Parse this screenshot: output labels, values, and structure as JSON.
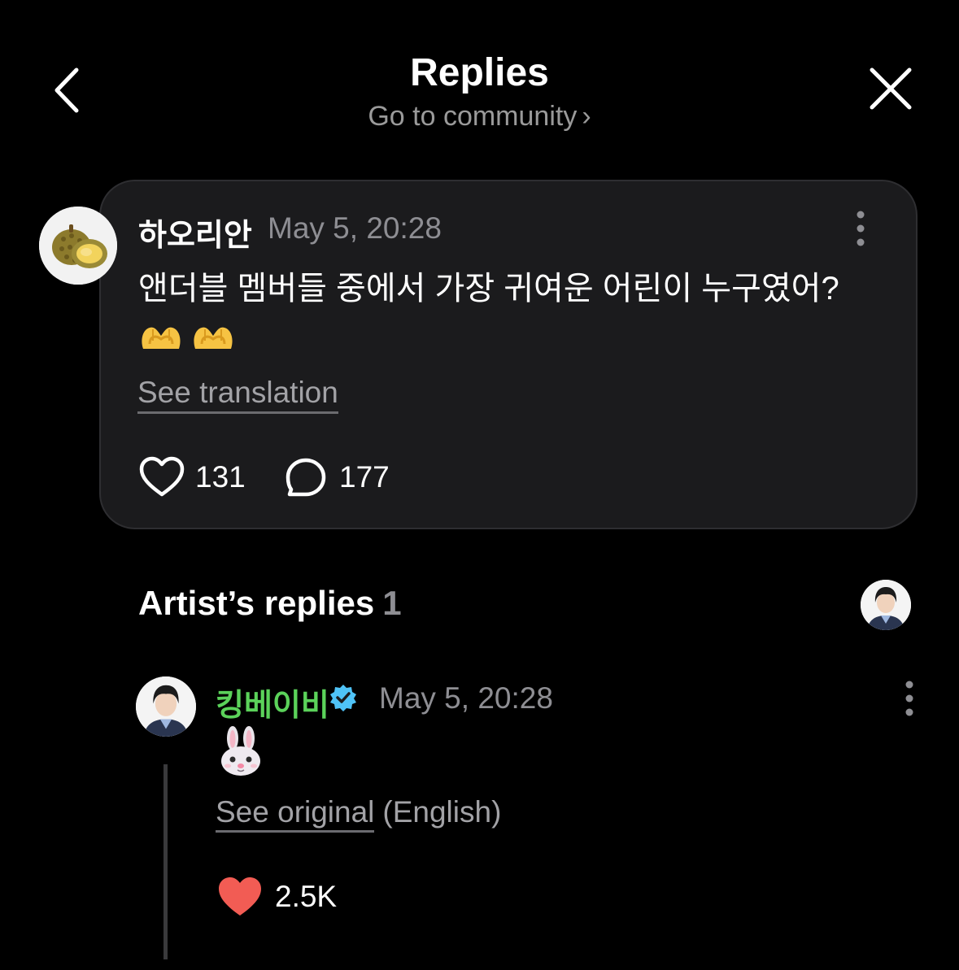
{
  "header": {
    "title": "Replies",
    "community_link": "Go to community",
    "chevron": "›",
    "back_icon": "chevron-left-icon",
    "close_icon": "close-icon"
  },
  "post": {
    "author": "하오리안",
    "timestamp": "May 5, 20:28",
    "text": "앤더블 멤버들 중에서 가장 귀여운 어린이 누구였어?",
    "emoji": [
      "heart-hands-emoji",
      "heart-hands-emoji"
    ],
    "see_translation": "See translation",
    "likes": "131",
    "comments": "177",
    "avatar_icon": "durian-avatar"
  },
  "artist_replies": {
    "heading": "Artist’s replies",
    "count": "1",
    "reply": {
      "author": "킹베이비",
      "verified": true,
      "timestamp": "May 5, 20:28",
      "emoji": "rabbit-face-emoji",
      "see_original": "See original",
      "language_note": "(English)",
      "likes": "2.5K"
    }
  },
  "colors": {
    "background": "#000000",
    "card": "#1b1b1d",
    "muted_text": "#8e8e93",
    "artist_name": "#5bd25a",
    "verified_badge": "#4fc3f7",
    "liked_heart": "#f25c54"
  }
}
